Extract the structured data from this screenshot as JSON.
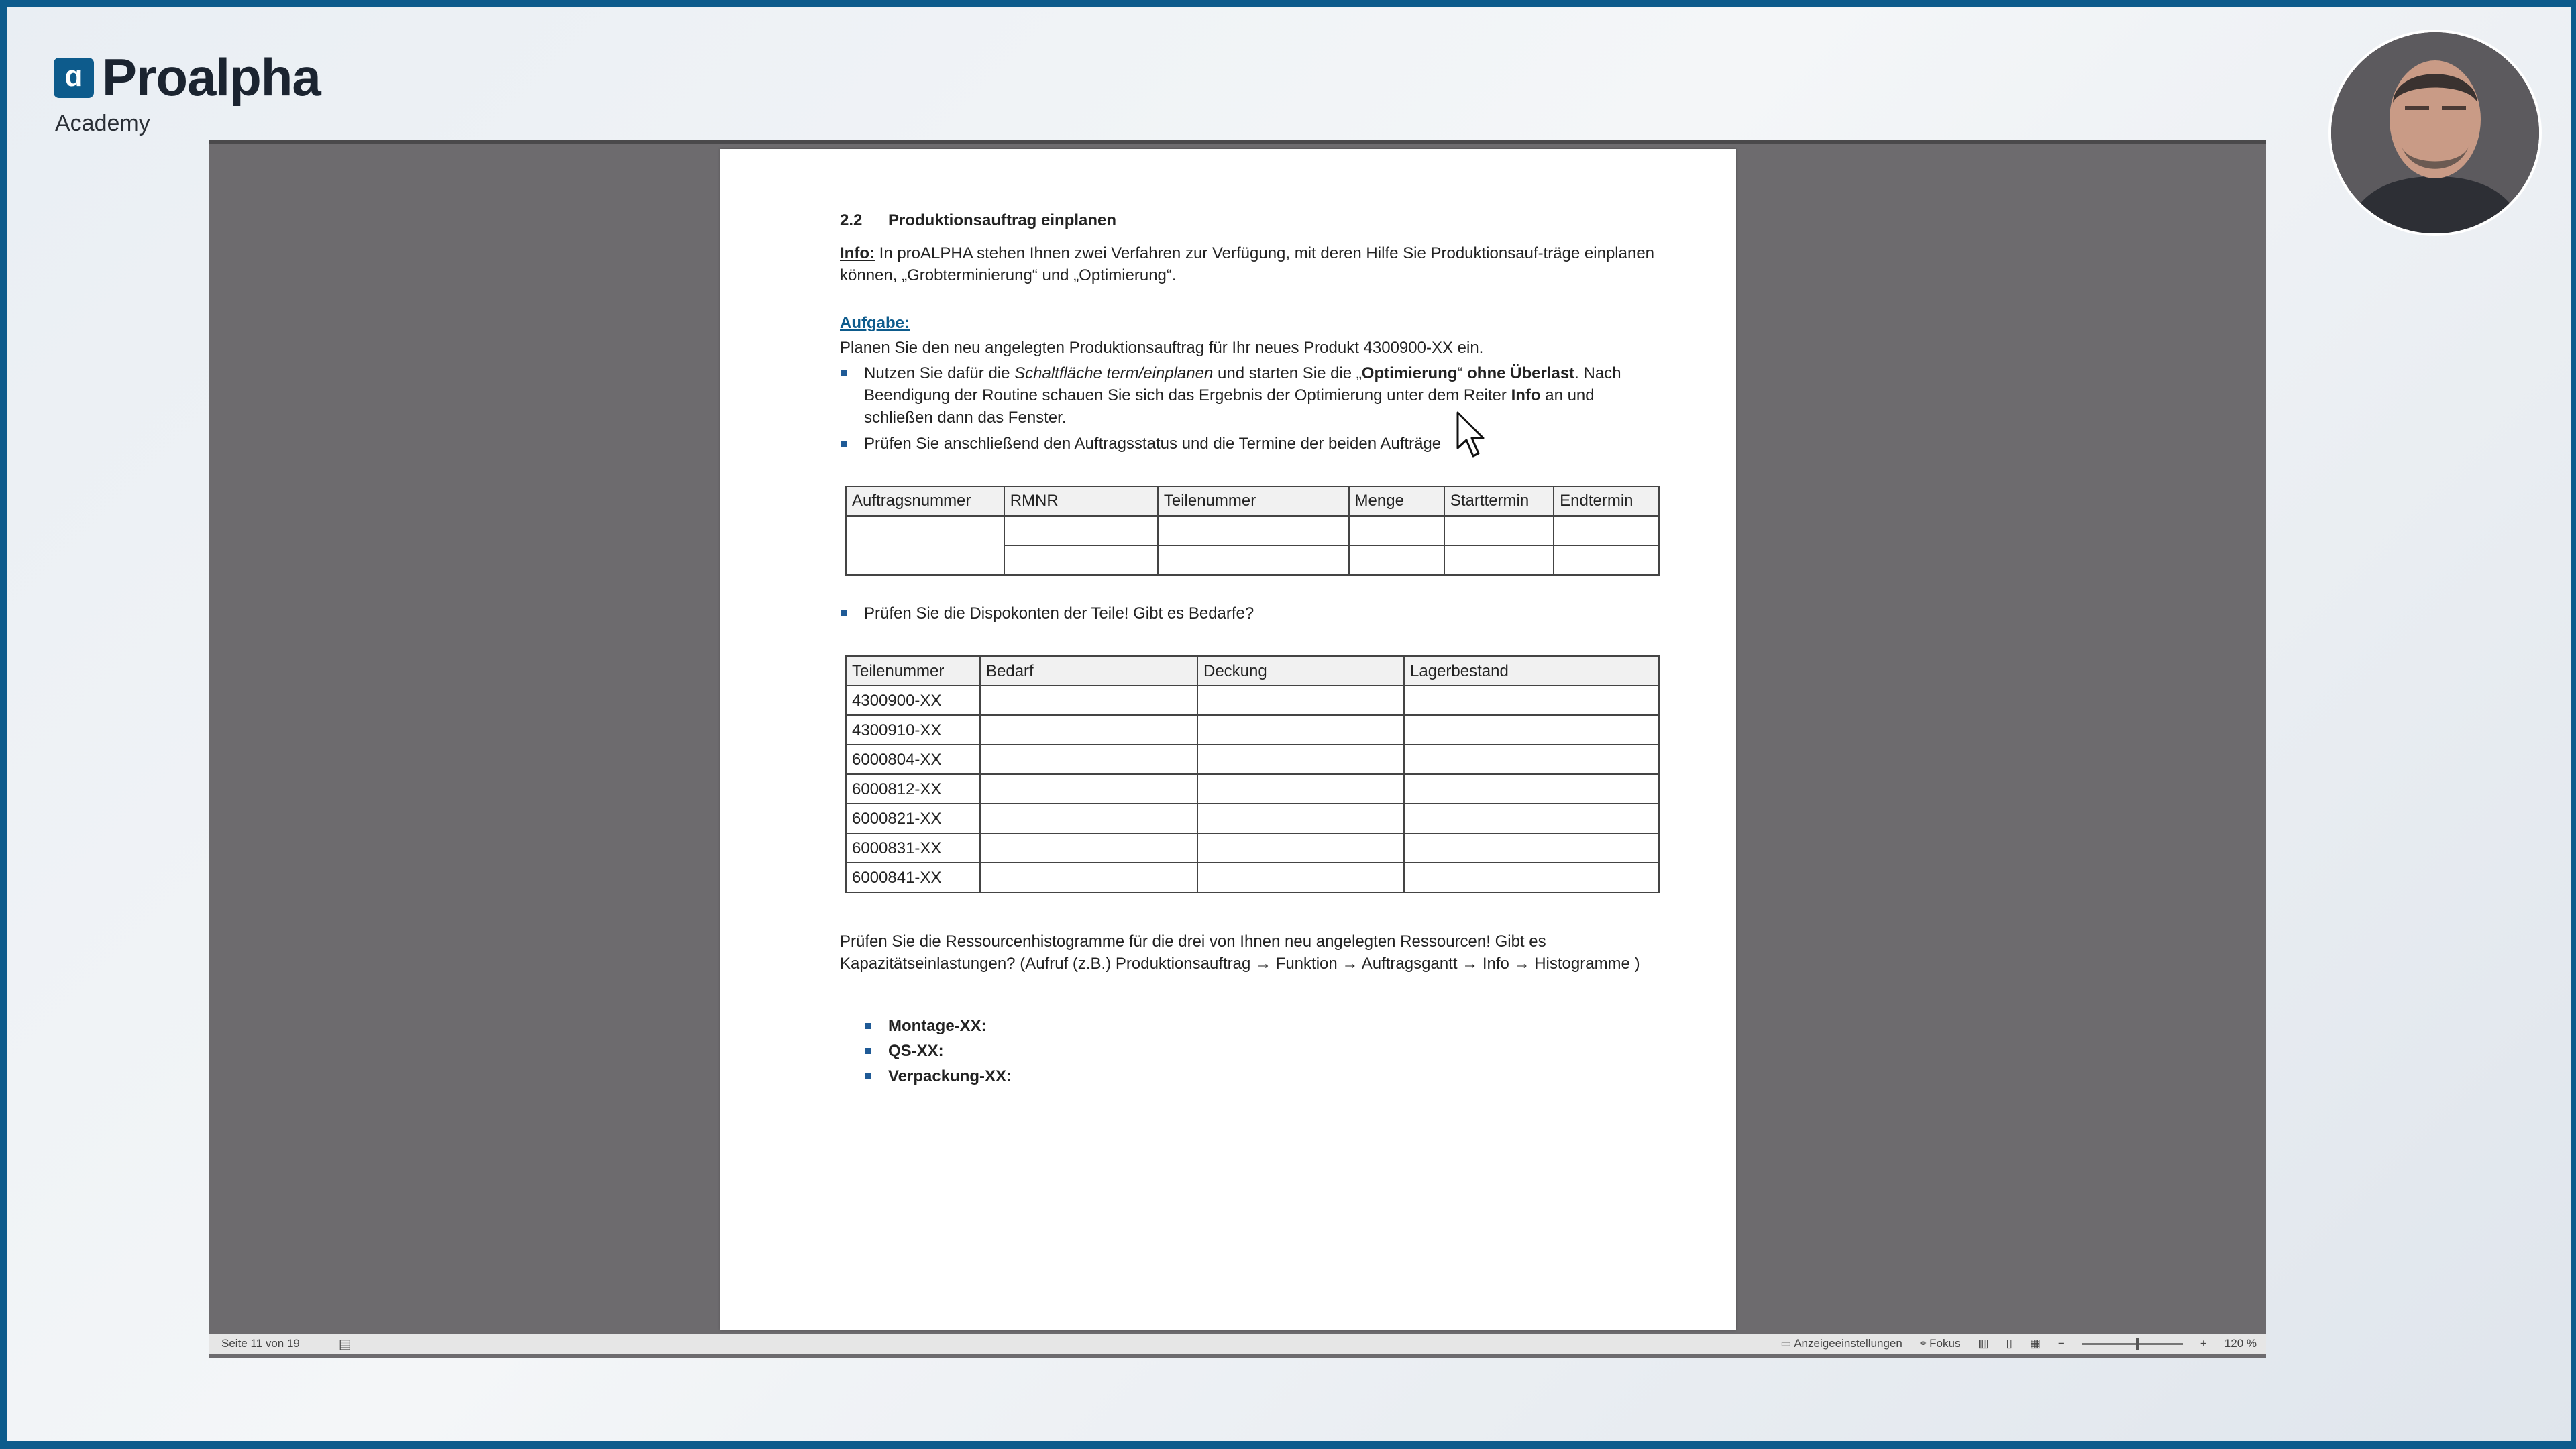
{
  "brand": {
    "logo_glyph": "ɑ",
    "name": "Proalpha",
    "subtitle": "Academy",
    "color": "#0d5b8c"
  },
  "document": {
    "section_number": "2.2",
    "section_title": "Produktionsauftrag einplanen",
    "info_label": "Info:",
    "info_text": " In proALPHA stehen Ihnen zwei Verfahren zur Verfügung, mit deren Hilfe Sie Produktionsauf-träge einplanen können, „Grobterminierung“ und „Optimierung“.",
    "task_label": "Aufgabe:",
    "task_intro": "Planen Sie den neu angelegten Produktionsauftrag für Ihr neues Produkt 4300900-XX ein.",
    "bullet1": {
      "a": "Nutzen Sie dafür die ",
      "b_italic": "Schaltfläche term/einplanen",
      "c": " und starten Sie die „",
      "d_bold": "Optimierung",
      "e": "“ ",
      "f_bold": "ohne Überlast",
      "g": ". Nach Beendigung der Routine schauen Sie sich das Ergebnis der Optimierung unter dem Reiter ",
      "h_bold": "Info",
      "i": " an und schließen dann das Fenster."
    },
    "bullet2": "Prüfen Sie anschließend den Auftragsstatus und die Termine der beiden Aufträge",
    "table1": {
      "headers": [
        "Auftragsnummer",
        "RMNR",
        "Teilenummer",
        "Menge",
        "Starttermin",
        "Endtermin"
      ]
    },
    "bullet3": "Prüfen Sie die Dispokonten der Teile! Gibt es Bedarfe?",
    "table2": {
      "headers": [
        "Teilenummer",
        "Bedarf",
        "Deckung",
        "Lagerbestand"
      ],
      "rows": [
        "4300900-XX",
        "4300910-XX",
        "6000804-XX",
        "6000812-XX",
        "6000821-XX",
        "6000831-XX",
        "6000841-XX"
      ]
    },
    "resources_text": "Prüfen Sie die Ressourcenhistogramme für die drei von Ihnen neu angelegten Ressourcen! Gibt es Kapazitätseinlastungen? (Aufruf (z.B.) Produktionsauftrag → Funktion → Auftragsgantt → Info → Histogramme )",
    "resources": [
      "Montage-XX:",
      "QS-XX:",
      "Verpackung-XX:"
    ]
  },
  "statusbar": {
    "page_info": "Seite 11 von 19",
    "display_settings": "Anzeigeeinstellungen",
    "focus": "Fokus",
    "zoom": "120 %",
    "zoom_minus": "−",
    "zoom_plus": "+"
  },
  "icons": [
    "brand-logo-icon",
    "proofing-icon",
    "display-settings-icon",
    "focus-icon",
    "read-mode-icon",
    "print-layout-icon",
    "web-layout-icon",
    "mouse-cursor-icon"
  ]
}
